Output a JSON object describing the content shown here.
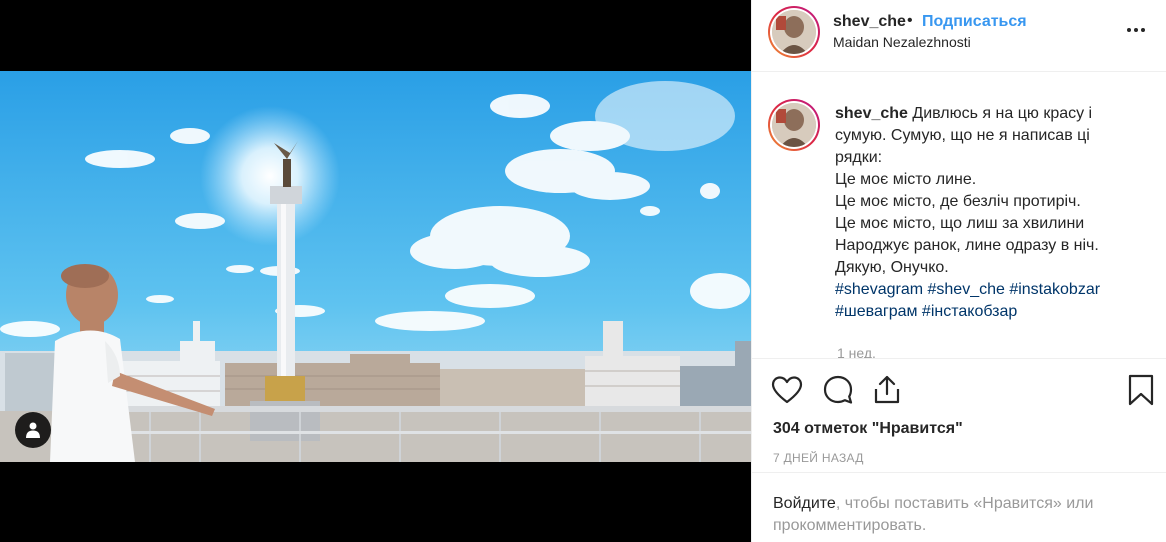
{
  "post": {
    "username": "shev_che",
    "separator": "•",
    "follow_label": "Подписаться",
    "location": "Maidan Nezalezhnosti"
  },
  "caption": {
    "username": "shev_che",
    "lines": [
      "Дивлюсь я на цю красу і",
      "сумую. Сумую, що не я написав ці",
      "рядки:",
      "Це моє місто лине.",
      "Це моє місто, де безліч протиріч.",
      "Це моє місто, що лиш за хвилини",
      "Народжує ранок, лине одразу в ніч.",
      "Дякую, Онучко."
    ],
    "hashtags_line1": "#shevagram #shev_che #instakobzar",
    "hashtags_line2": "#шеваграм #інстакобзар",
    "ago": "1 нед."
  },
  "actions": {
    "like_icon": "heart-icon",
    "comment_icon": "comment-icon",
    "share_icon": "share-icon",
    "save_icon": "bookmark-icon"
  },
  "likes": "304 отметок \"Нравится\"",
  "time": "7 ДНЕЙ НАЗАД",
  "login": {
    "link": "Войдите",
    "text": ", чтобы поставить «Нравится» или прокомментировать."
  },
  "colors": {
    "accent": "#3897f0",
    "hashtag": "#003569",
    "muted": "#999999"
  }
}
